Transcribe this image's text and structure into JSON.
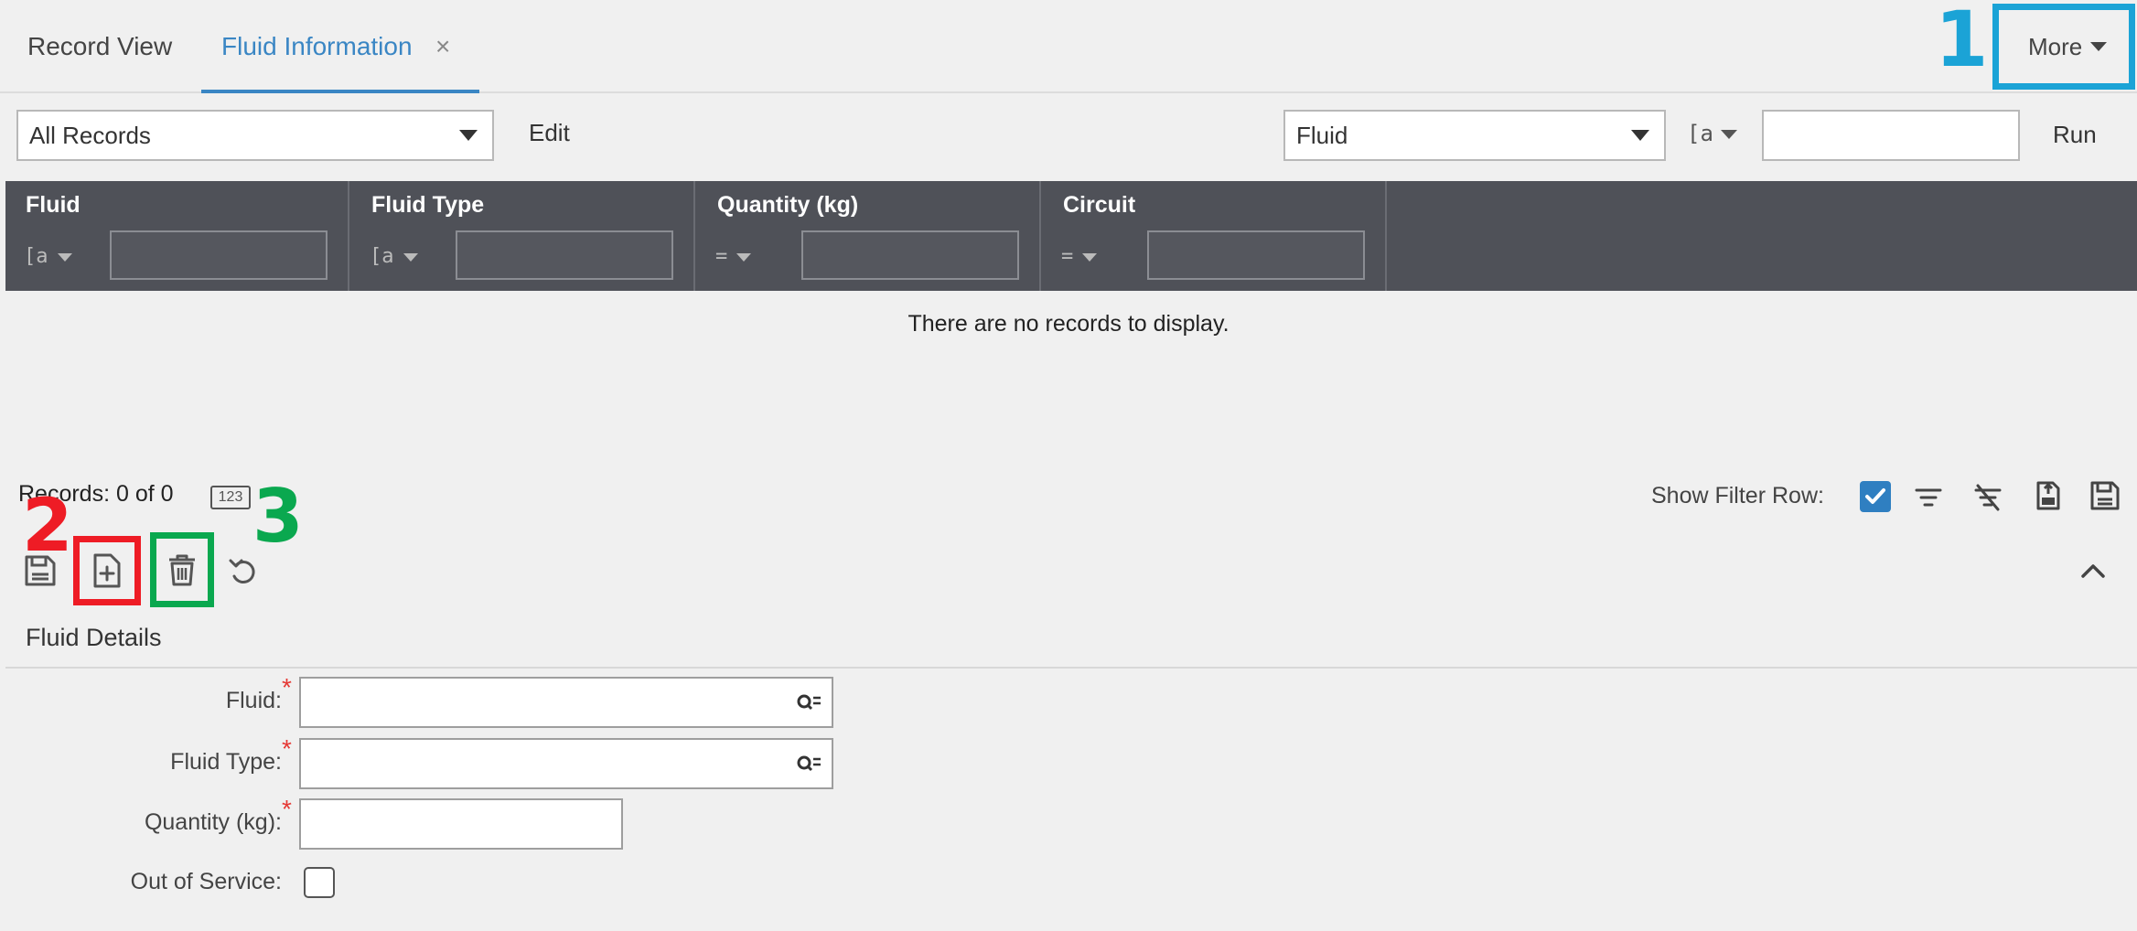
{
  "tabs": {
    "record_view": "Record View",
    "fluid_information": "Fluid Information",
    "close_glyph": "×"
  },
  "more_button": "More",
  "annotations": {
    "one": "1",
    "two": "2",
    "three": "3"
  },
  "toolbar": {
    "records_select": "All Records",
    "edit": "Edit",
    "field_select": "Fluid",
    "filter_operator": "[a",
    "search_value": "",
    "run": "Run"
  },
  "grid": {
    "columns": [
      {
        "title": "Fluid",
        "operator": "[a"
      },
      {
        "title": "Fluid Type",
        "operator": "[a"
      },
      {
        "title": "Quantity (kg)",
        "operator": "="
      },
      {
        "title": "Circuit",
        "operator": "="
      }
    ],
    "empty_message": "There are no records to display."
  },
  "status": {
    "records": "Records: 0 of 0",
    "counter_icon": "123",
    "show_filter_row": "Show Filter Row:",
    "show_filter_row_checked": true
  },
  "details": {
    "title": "Fluid Details",
    "fields": {
      "fluid": "Fluid:",
      "fluid_type": "Fluid Type:",
      "quantity": "Quantity (kg):",
      "out_of_service": "Out of Service:"
    },
    "required_mark": "*",
    "out_of_service_checked": false
  },
  "colors": {
    "accent": "#3a86c4",
    "header_bg": "#4f5158",
    "annotation_blue": "#1ba3d6",
    "annotation_red": "#ee1c25",
    "annotation_green": "#0aa84f",
    "required": "#e53935"
  },
  "icons": {
    "save": "save-icon",
    "new_record": "new-record-icon",
    "delete": "trash-icon",
    "undo": "undo-icon",
    "collapse": "chevron-up-icon",
    "filter": "filter-icon",
    "clear_filter": "clear-filter-icon",
    "export": "export-icon",
    "save_layout": "save-layout-icon",
    "lookup": "lookup-search-icon"
  }
}
